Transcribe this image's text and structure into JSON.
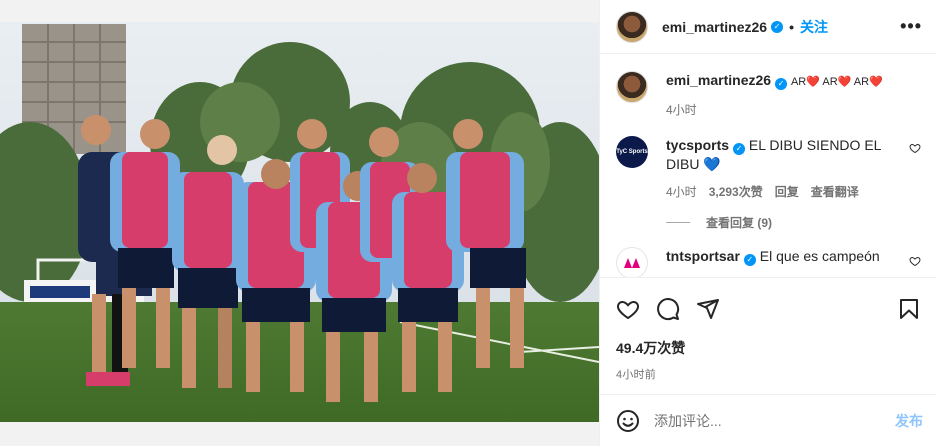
{
  "post": {
    "username": "emi_martinez26",
    "follow_label": "关注",
    "more_label": "•••",
    "photo_alt": "Argentina national team players posing on a training pitch"
  },
  "caption": {
    "username": "emi_martinez26",
    "text": "AR❤️ AR❤️ AR❤️",
    "time": "4小时"
  },
  "comments": [
    {
      "username": "tycsports",
      "avatar_text": "TyC Sports",
      "text": "EL DIBU SIENDO EL DIBU 💙",
      "time": "4小时",
      "likes": "3,293次赞",
      "reply_label": "回复",
      "translate_label": "查看翻译",
      "view_replies": "查看回复 (9)"
    },
    {
      "username": "tntsportsar",
      "text": "El que es campeón"
    }
  ],
  "actions": {
    "likes": "49.4万次赞",
    "time": "4小时前"
  },
  "composer": {
    "placeholder": "添加评论...",
    "post_label": "发布"
  },
  "colors": {
    "accent": "#0095f6",
    "jersey": "#d63d6b",
    "sky_shirt": "#74acdf"
  }
}
